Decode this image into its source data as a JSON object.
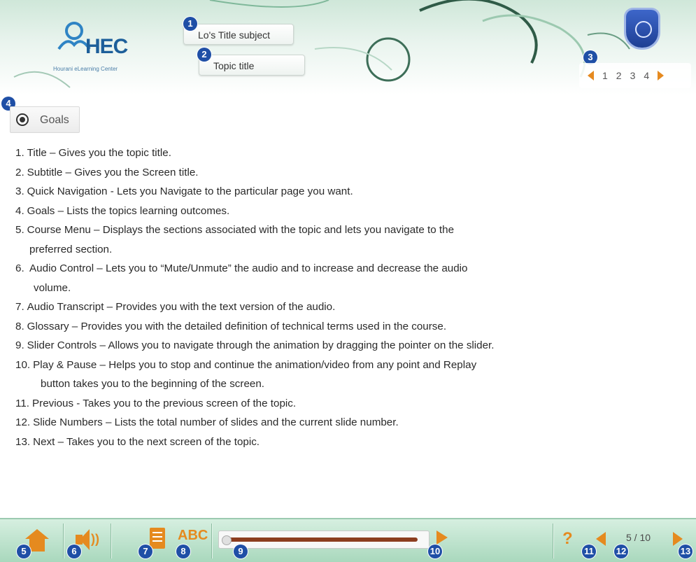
{
  "header": {
    "logo_text": "HEC",
    "logo_sub": "Hourani eLearning Center",
    "lo_title": "Lo's Title subject",
    "topic_title": "Topic title",
    "quick_nav": {
      "pages": [
        "1",
        "2",
        "3",
        "4"
      ],
      "prev_icon": "prev-page-arrow-icon",
      "next_icon": "next-page-arrow-icon"
    },
    "crest_icon": "university-crest-icon"
  },
  "goals": {
    "label": "Goals",
    "icon": "target-icon"
  },
  "markers": {
    "m1": "1",
    "m2": "2",
    "m3": "3",
    "m4": "4",
    "m5": "5",
    "m6": "6",
    "m7": "7",
    "m8": "8",
    "m9": "9",
    "m10": "10",
    "m11": "11",
    "m12": "12",
    "m13": "13"
  },
  "items": [
    {
      "num": "1.",
      "text": "Title – Gives you the topic title."
    },
    {
      "num": "2.",
      "text": "Subtitle – Gives you the Screen title."
    },
    {
      "num": "3.",
      "text": "Quick Navigation - Lets you Navigate to the particular page you want."
    },
    {
      "num": "4.",
      "text": "Goals – Lists the topics learning outcomes."
    },
    {
      "num": "5.",
      "text": "Course Menu – Displays the sections associated with the topic and lets you navigate to the",
      "cont": "preferred section."
    },
    {
      "num": "6.",
      "text": " Audio Control – Lets you to “Mute/Unmute” the audio and to increase and decrease the audio",
      "cont": "volume."
    },
    {
      "num": "7.",
      "text": "Audio Transcript – Provides you with the text version of the audio."
    },
    {
      "num": "8.",
      "text": "Glossary – Provides you with the detailed definition of technical terms used in the course."
    },
    {
      "num": "9.",
      "text": "Slider Controls – Allows you to navigate through the animation by dragging the pointer on the slider."
    },
    {
      "num": "10.",
      "text": "Play & Pause – Helps you to stop and continue the animation/video from any point and Replay",
      "cont": "button takes you to the beginning of the screen."
    },
    {
      "num": "11.",
      "text": "Previous - Takes you to the previous screen of the topic."
    },
    {
      "num": "12.",
      "text": "Slide Numbers – Lists the total number of slides and the current slide number."
    },
    {
      "num": "13.",
      "text": "Next – Takes you to the next screen of the topic."
    }
  ],
  "toolbar": {
    "glossary_label": "ABC",
    "help_label": "?",
    "slide_counter": "5 / 10",
    "slider_progress": 0.98,
    "icons": [
      "home-icon",
      "audio-icon",
      "transcript-icon",
      "glossary-icon",
      "slider-track",
      "play-icon",
      "help-icon",
      "prev-icon",
      "next-icon"
    ]
  },
  "colors": {
    "accent": "#e58a1f",
    "marker": "#1f4fa6",
    "toolbar": "#a9d8bd",
    "slider_fill": "#8c3d1f"
  }
}
